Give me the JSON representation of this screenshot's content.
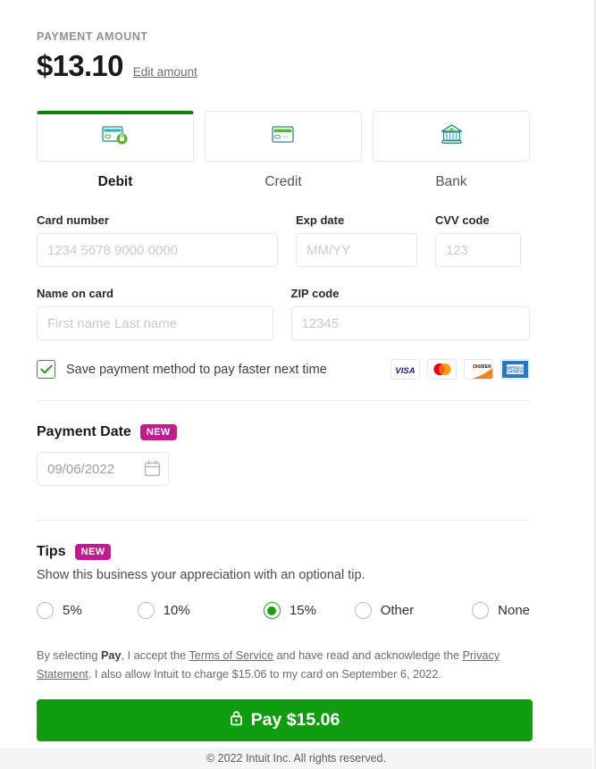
{
  "amount_section": {
    "label": "PAYMENT AMOUNT",
    "value": "$13.10",
    "edit_link": "Edit amount"
  },
  "method_tabs": [
    {
      "label": "Debit",
      "icon": "debit-card-icon",
      "selected": true
    },
    {
      "label": "Credit",
      "icon": "credit-card-icon",
      "selected": false
    },
    {
      "label": "Bank",
      "icon": "bank-icon",
      "selected": false
    }
  ],
  "card_form": {
    "card_number": {
      "label": "Card number",
      "placeholder": "1234 5678 9000 0000",
      "value": ""
    },
    "exp_date": {
      "label": "Exp date",
      "placeholder": "MM/YY",
      "value": ""
    },
    "cvv": {
      "label": "CVV code",
      "placeholder": "123",
      "value": ""
    },
    "name_on_card": {
      "label": "Name on card",
      "placeholder": "First name Last name",
      "value": ""
    },
    "zip": {
      "label": "ZIP code",
      "placeholder": "12345",
      "value": ""
    }
  },
  "save_method": {
    "label": "Save payment method to pay faster next time",
    "checked": true,
    "accepted_brands": [
      "VISA",
      "Mastercard",
      "DISCOVER",
      "AMEX"
    ]
  },
  "payment_date": {
    "title": "Payment Date",
    "badge": "NEW",
    "value": "09/06/2022",
    "icon": "calendar-icon"
  },
  "tips": {
    "title": "Tips",
    "badge": "NEW",
    "description": "Show this business your appreciation with an optional tip.",
    "options": [
      {
        "label": "5%",
        "selected": false
      },
      {
        "label": "10%",
        "selected": false
      },
      {
        "label": "15%",
        "selected": true
      },
      {
        "label": "Other",
        "selected": false
      },
      {
        "label": "None",
        "selected": false
      }
    ]
  },
  "legal": {
    "part1": "By selecting ",
    "bold1": "Pay",
    "part2": ", I accept the ",
    "link1": "Terms of Service",
    "part3": " and have read and acknowledge the ",
    "link2": "Privacy Statement",
    "part4": ". I also allow Intuit to charge $15.06 to my card on September 6, 2022."
  },
  "pay_button": {
    "label": "Pay $15.06",
    "icon": "lock-icon",
    "color": "#0f9d0f"
  },
  "footer": {
    "text": "© 2022 Intuit Inc. All rights reserved."
  },
  "colors": {
    "accent_green": "#2ca01c",
    "selected_tab_bar": "#108000",
    "badge_magenta": "#c41a8f",
    "pay_button_green": "#0f9d0f"
  }
}
